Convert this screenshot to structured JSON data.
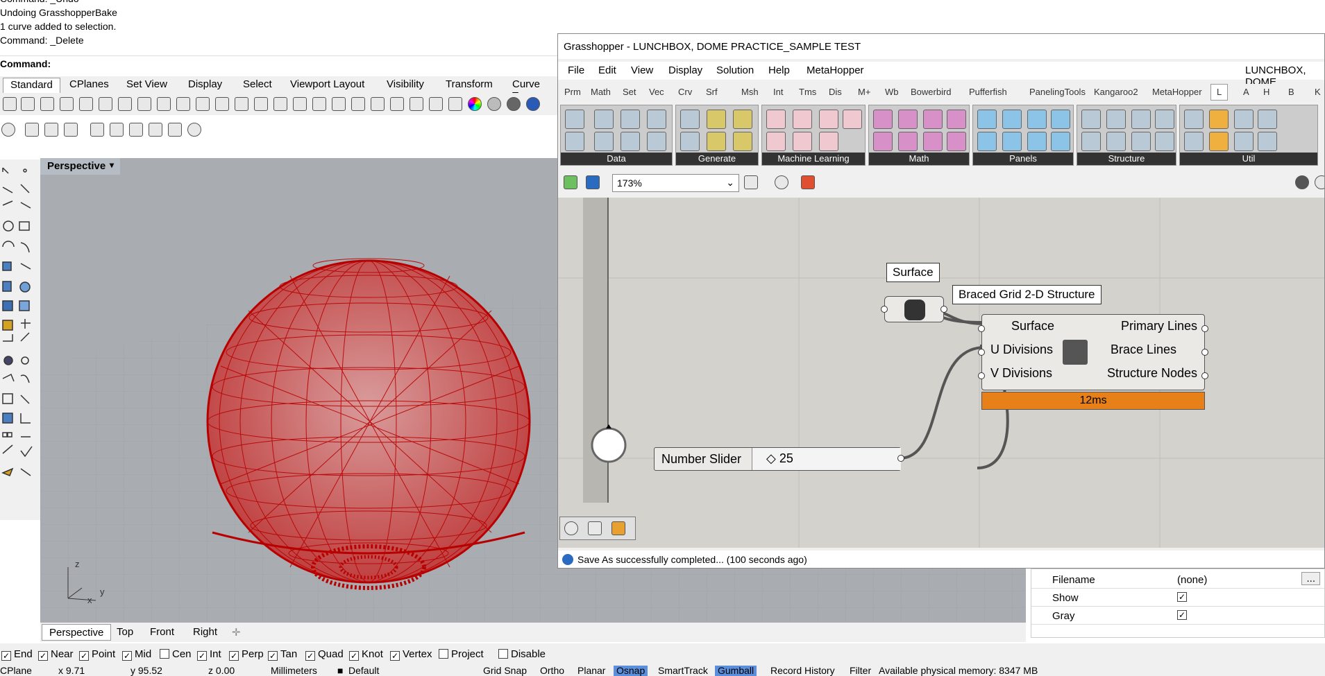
{
  "command_history": {
    "lines": [
      "Command: _Undo",
      "Undoing GrasshopperBake",
      "1 curve added to selection.",
      "Command: _Delete"
    ],
    "prompt": "Command:"
  },
  "rhino_tabs": [
    "Standard",
    "CPlanes",
    "Set View",
    "Display",
    "Select",
    "Viewport Layout",
    "Visibility",
    "Transform",
    "Curve Too"
  ],
  "viewport": {
    "title": "Perspective",
    "axis_z": "z",
    "axis_x": "x",
    "axis_y": "y"
  },
  "viewport_tabs": [
    "Perspective",
    "Top",
    "Front",
    "Right"
  ],
  "osnap": {
    "items": [
      {
        "label": "End",
        "checked": true
      },
      {
        "label": "Near",
        "checked": true
      },
      {
        "label": "Point",
        "checked": true
      },
      {
        "label": "Mid",
        "checked": true
      },
      {
        "label": "Cen",
        "checked": false
      },
      {
        "label": "Int",
        "checked": true
      },
      {
        "label": "Perp",
        "checked": true
      },
      {
        "label": "Tan",
        "checked": true
      },
      {
        "label": "Quad",
        "checked": true
      },
      {
        "label": "Knot",
        "checked": true
      },
      {
        "label": "Vertex",
        "checked": true
      },
      {
        "label": "Project",
        "checked": false
      },
      {
        "label": "Disable",
        "checked": false
      }
    ]
  },
  "status_bar": {
    "cplane": "CPlane",
    "x": "x 9.71",
    "y": "y 95.52",
    "z": "z 0.00",
    "units": "Millimeters",
    "layer": "Default",
    "grid_snap": "Grid Snap",
    "ortho": "Ortho",
    "planar": "Planar",
    "osnap": "Osnap",
    "smarttrack": "SmartTrack",
    "gumball": "Gumball",
    "record_history": "Record History",
    "filter": "Filter",
    "memory": "Available physical memory: 8347 MB"
  },
  "properties": {
    "rows": [
      {
        "key": "Filename",
        "value": "(none)"
      },
      {
        "key": "Show",
        "value": "✓"
      },
      {
        "key": "Gray",
        "value": "✓"
      }
    ],
    "browse": "..."
  },
  "grasshopper": {
    "title": "Grasshopper - LUNCHBOX, DOME PRACTICE_SAMPLE TEST",
    "menu": [
      "File",
      "Edit",
      "View",
      "Display",
      "Solution",
      "Help",
      "MetaHopper"
    ],
    "doc_name": "LUNCHBOX, DOME",
    "tabs": [
      "Prm",
      "Math",
      "Set",
      "Vec",
      "Crv",
      "Srf",
      "Msh",
      "Int",
      "Tms",
      "Dis",
      "M+",
      "Wb",
      "Bowerbird",
      "Pufferfish",
      "PanelingTools",
      "Kangaroo2",
      "MetaHopper",
      "L",
      "A",
      "H",
      "B",
      "K"
    ],
    "panels": [
      "Data",
      "Generate",
      "Machine Learning",
      "Math",
      "Panels",
      "Structure",
      "Util"
    ],
    "zoom": "173%",
    "surface_label": "Surface",
    "component_title": "Braced Grid 2-D Structure",
    "inputs": [
      "Surface",
      "U Divisions",
      "V Divisions"
    ],
    "outputs": [
      "Primary Lines",
      "Brace Lines",
      "Structure Nodes"
    ],
    "timing": "12ms",
    "slider_label": "Number Slider",
    "slider_value": "◇ 25",
    "status": "Save As successfully completed... (100 seconds ago)"
  },
  "colors": {
    "accent_orange": "#e8801a",
    "dome_red": "#b80000",
    "osnap_highlight": "#5b8edb"
  }
}
